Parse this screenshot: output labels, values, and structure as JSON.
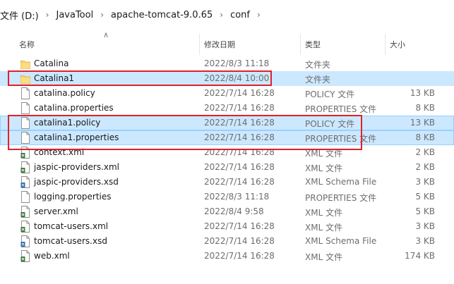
{
  "breadcrumb": [
    "文件 (D:)",
    "JavaTool",
    "apache-tomcat-9.0.65",
    "conf"
  ],
  "columns": {
    "name": "名称",
    "date": "修改日期",
    "type": "类型",
    "size": "大小"
  },
  "files": [
    {
      "name": "Catalina",
      "date": "2022/8/3 11:18",
      "type": "文件夹",
      "size": "",
      "icon": "folder-icon",
      "selected": false
    },
    {
      "name": "Catalina1",
      "date": "2022/8/4 10:00",
      "type": "文件夹",
      "size": "",
      "icon": "folder-icon",
      "selected": true
    },
    {
      "name": "catalina.policy",
      "date": "2022/7/14 16:28",
      "type": "POLICY 文件",
      "size": "13 KB",
      "icon": "file-icon",
      "selected": false
    },
    {
      "name": "catalina.properties",
      "date": "2022/7/14 16:28",
      "type": "PROPERTIES 文件",
      "size": "8 KB",
      "icon": "file-icon",
      "selected": false
    },
    {
      "name": "catalina1.policy",
      "date": "2022/7/14 16:28",
      "type": "POLICY 文件",
      "size": "13 KB",
      "icon": "file-icon",
      "selected": true
    },
    {
      "name": "catalina1.properties",
      "date": "2022/7/14 16:28",
      "type": "PROPERTIES 文件",
      "size": "8 KB",
      "icon": "file-icon",
      "selected": true
    },
    {
      "name": "context.xml",
      "date": "2022/7/14 16:28",
      "type": "XML 文件",
      "size": "2 KB",
      "icon": "xml-file-icon",
      "selected": false
    },
    {
      "name": "jaspic-providers.xml",
      "date": "2022/7/14 16:28",
      "type": "XML 文件",
      "size": "2 KB",
      "icon": "xml-file-icon",
      "selected": false
    },
    {
      "name": "jaspic-providers.xsd",
      "date": "2022/7/14 16:28",
      "type": "XML Schema File",
      "size": "3 KB",
      "icon": "xsd-file-icon",
      "selected": false
    },
    {
      "name": "logging.properties",
      "date": "2022/8/3 11:18",
      "type": "PROPERTIES 文件",
      "size": "5 KB",
      "icon": "file-icon",
      "selected": false
    },
    {
      "name": "server.xml",
      "date": "2022/8/4 9:58",
      "type": "XML 文件",
      "size": "5 KB",
      "icon": "xml-file-icon",
      "selected": false
    },
    {
      "name": "tomcat-users.xml",
      "date": "2022/7/14 16:28",
      "type": "XML 文件",
      "size": "3 KB",
      "icon": "xml-file-icon",
      "selected": false
    },
    {
      "name": "tomcat-users.xsd",
      "date": "2022/7/14 16:28",
      "type": "XML Schema File",
      "size": "3 KB",
      "icon": "xsd-file-icon",
      "selected": false
    },
    {
      "name": "web.xml",
      "date": "2022/7/14 16:28",
      "type": "XML 文件",
      "size": "174 KB",
      "icon": "xml-file-icon",
      "selected": false
    }
  ],
  "colors": {
    "selection": "#cce8ff",
    "annotation": "#e0212b",
    "folder": "#f8d36b"
  }
}
